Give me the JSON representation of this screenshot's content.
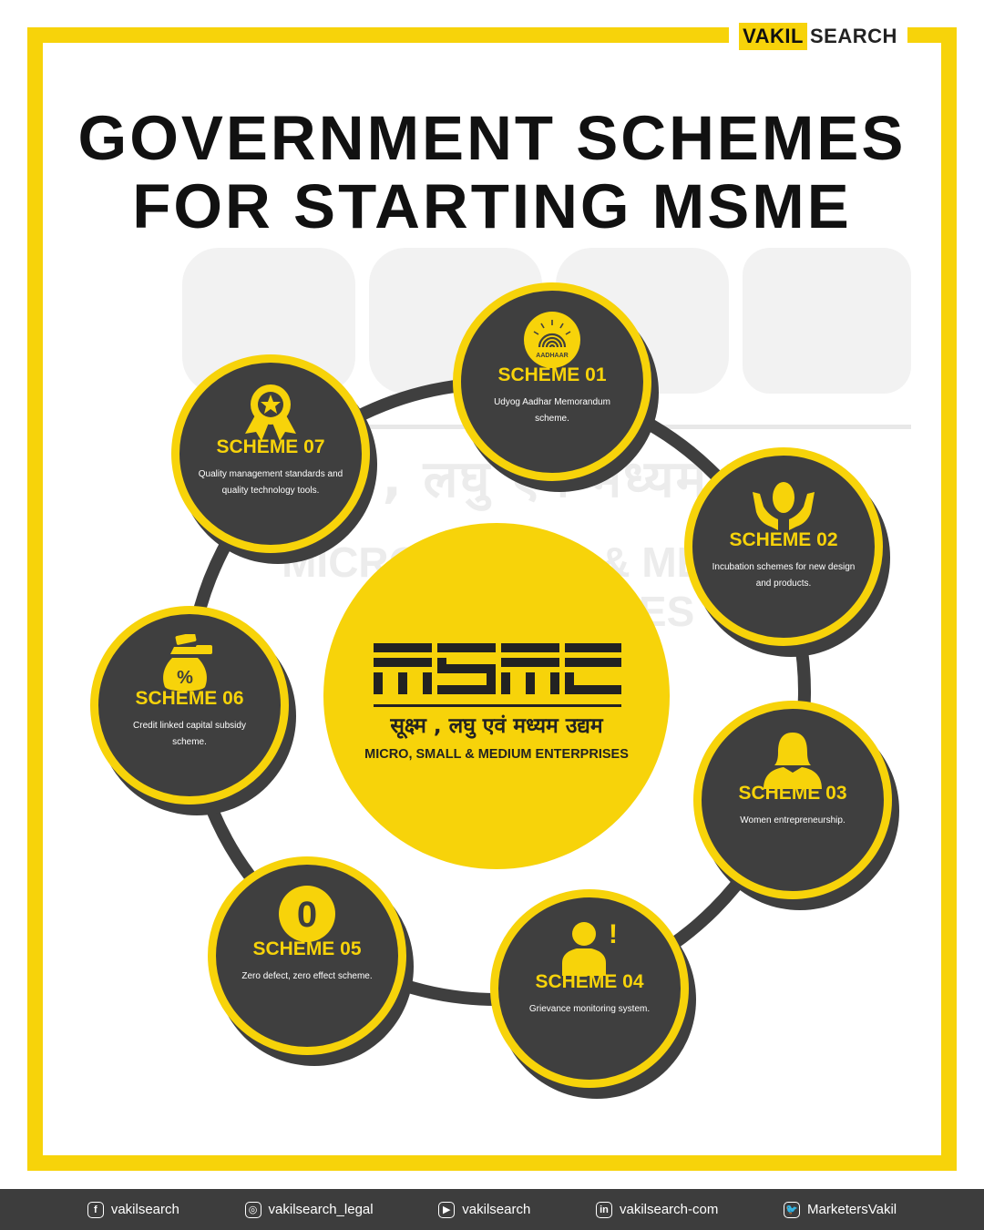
{
  "brand": {
    "part1": "VAKIL",
    "part2": "SEARCH"
  },
  "title": {
    "line1": "GOVERNMENT SCHEMES",
    "line2": "FOR STARTING MSME"
  },
  "center_logo": {
    "wordmark": "MSME",
    "hindi": "सूक्ष्म , लघु एवं मध्यम उद्यम",
    "english": "MICRO, SMALL & MEDIUM ENTERPRISES"
  },
  "watermark": {
    "hindi": "सूक्ष्म , लघु एवं मध्यम उद्यम",
    "english": "MICRO, SMALL & MEDIUM ENTERPRISES"
  },
  "schemes": [
    {
      "title": "SCHEME 01",
      "desc": "Udyog Aadhar Memorandum scheme.",
      "icon": "aadhaar-icon",
      "icon_text": "AADHAAR"
    },
    {
      "title": "SCHEME 02",
      "desc": "Incubation schemes for new design and products.",
      "icon": "egg-hands-icon"
    },
    {
      "title": "SCHEME 03",
      "desc": "Women entrepreneurship.",
      "icon": "woman-icon"
    },
    {
      "title": "SCHEME 04",
      "desc": "Grievance monitoring system.",
      "icon": "person-alert-icon",
      "icon_text": "!"
    },
    {
      "title": "SCHEME 05",
      "desc": "Zero defect, zero effect scheme.",
      "icon": "zero-icon",
      "icon_text": "0"
    },
    {
      "title": "SCHEME 06",
      "desc": "Credit linked capital subsidy scheme.",
      "icon": "money-bag-icon",
      "icon_text": "%"
    },
    {
      "title": "SCHEME 07",
      "desc": "Quality management standards and quality technology tools.",
      "icon": "award-badge-icon"
    }
  ],
  "footer": [
    {
      "icon": "facebook-icon",
      "glyph": "f",
      "handle": "vakilsearch"
    },
    {
      "icon": "instagram-icon",
      "glyph": "◎",
      "handle": "vakilsearch_legal"
    },
    {
      "icon": "youtube-icon",
      "glyph": "▶",
      "handle": "vakilsearch"
    },
    {
      "icon": "linkedin-icon",
      "glyph": "in",
      "handle": "vakilsearch-com"
    },
    {
      "icon": "twitter-icon",
      "glyph": "🐦",
      "handle": "MarketersVakil"
    }
  ],
  "colors": {
    "accent": "#f7d30a",
    "dark": "#3f3f3f",
    "text": "#111111"
  }
}
